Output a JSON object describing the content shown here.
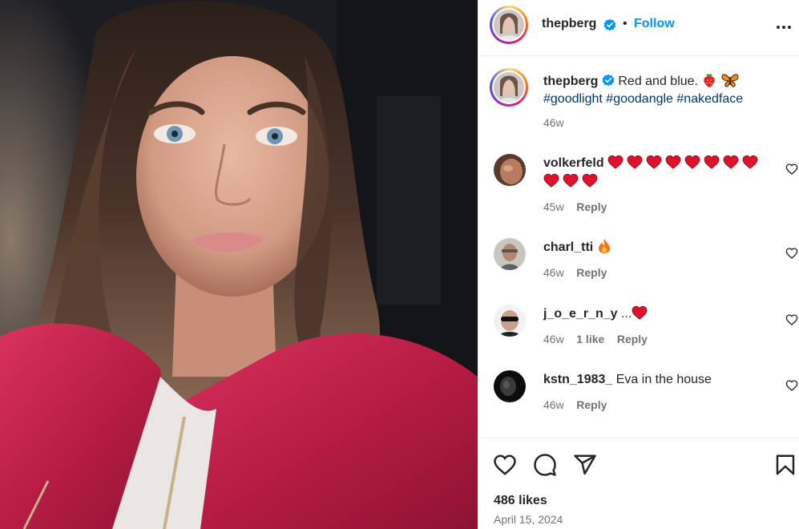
{
  "post": {
    "author": "thepberg",
    "follow_label": "Follow",
    "separator": "•",
    "more_icon": "more-horizontal-icon"
  },
  "caption": {
    "author": "thepberg",
    "text": "Red and blue.",
    "emojis": [
      "strawberry",
      "butterfly"
    ],
    "hashtags": [
      "#goodlight",
      "#goodangle",
      "#nakedface"
    ],
    "age": "46w"
  },
  "comments": [
    {
      "user": "volkerfeld",
      "text": "",
      "hearts": 11,
      "age": "45w",
      "likes": "",
      "reply": "Reply"
    },
    {
      "user": "charl_tti",
      "text": "",
      "emoji": "fire",
      "age": "46w",
      "likes": "",
      "reply": "Reply"
    },
    {
      "user": "j_o_e_r_n_y",
      "text": "...",
      "emoji": "red-heart",
      "age": "46w",
      "likes": "1 like",
      "reply": "Reply"
    },
    {
      "user": "kstn_1983_",
      "text": "Eva in the house",
      "age": "46w",
      "likes": "",
      "reply": "Reply"
    }
  ],
  "footer": {
    "likes": "486 likes",
    "date": "April 15, 2024"
  },
  "colors": {
    "follow": "#0095f6",
    "hashtag": "#00376b",
    "muted": "#737373",
    "heart": "#e0112b"
  }
}
